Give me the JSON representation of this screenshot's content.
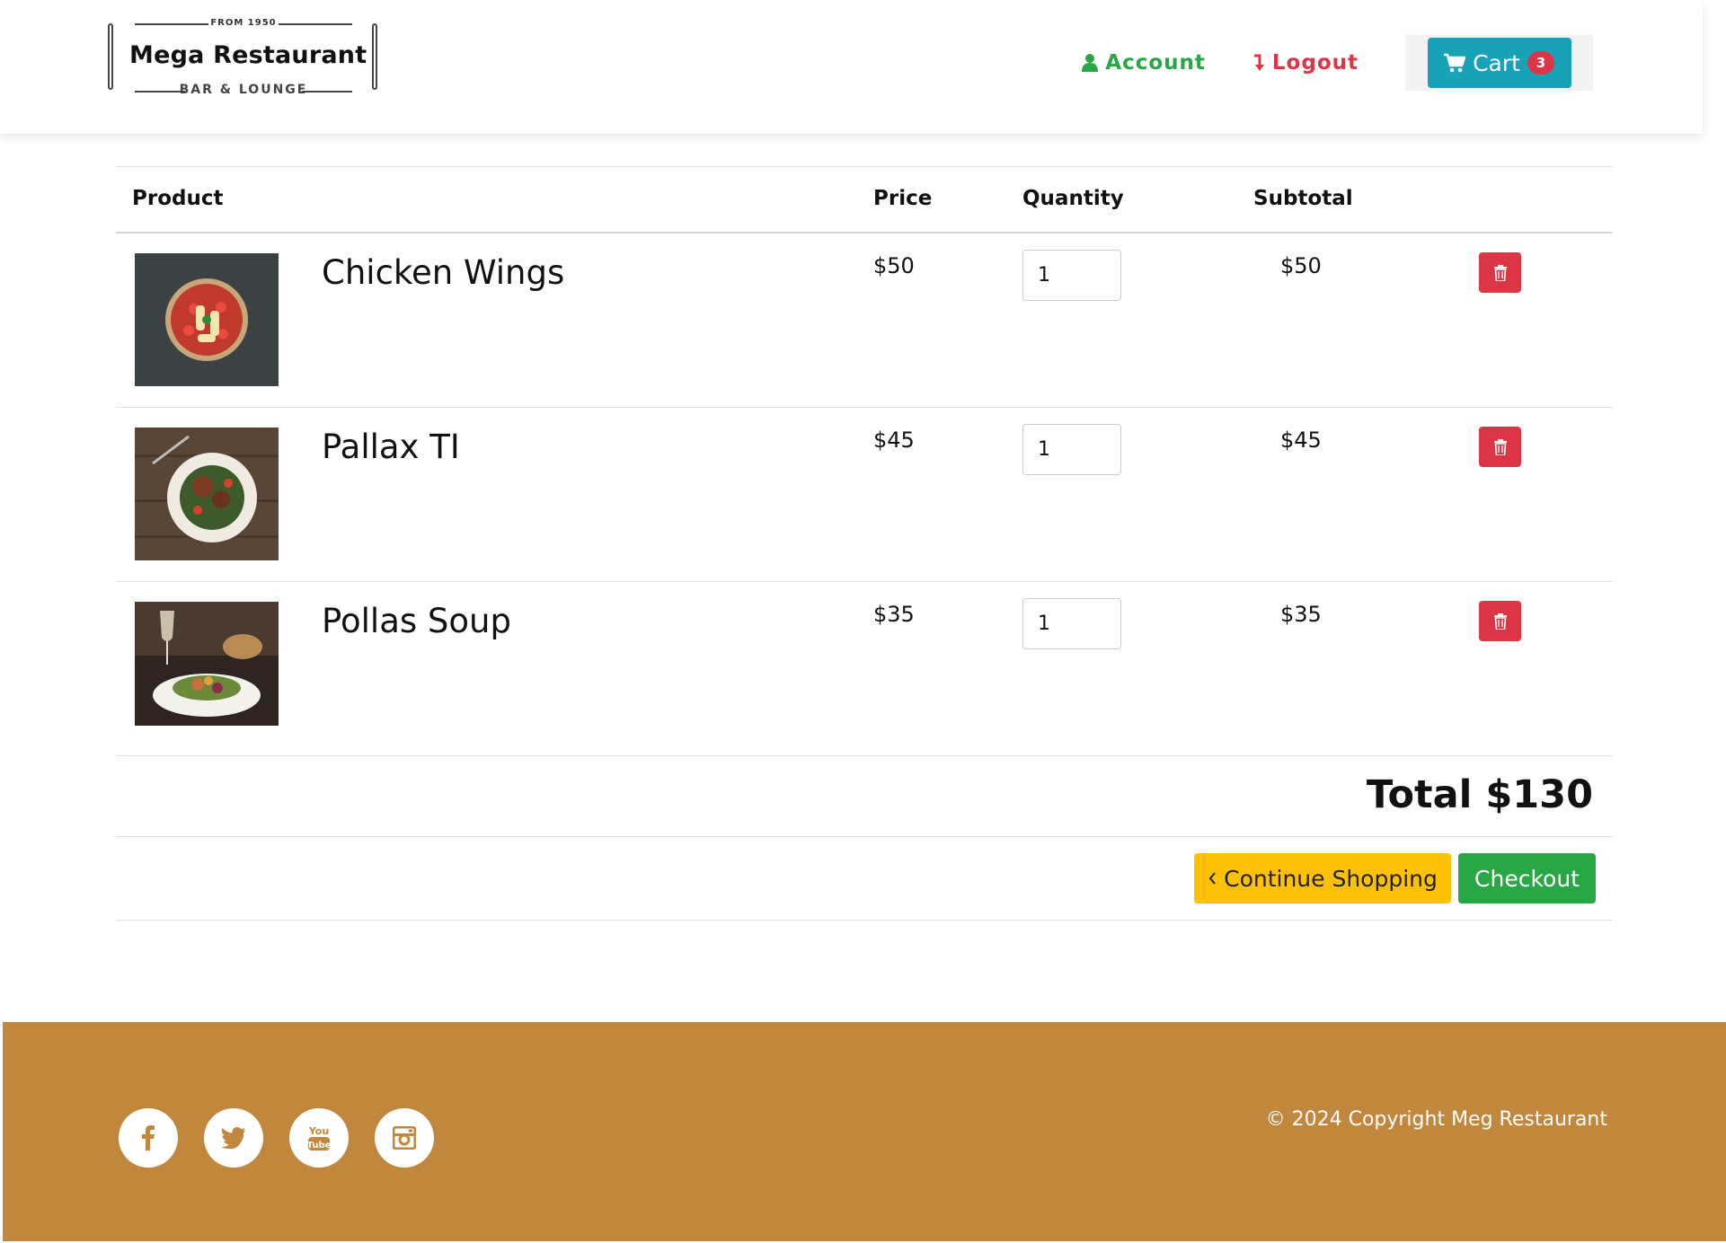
{
  "brand": {
    "from": "FROM 1950",
    "name": "Mega Restaurant",
    "tagline": "BAR & LOUNGE"
  },
  "nav": {
    "account": "Account",
    "logout": "Logout",
    "cart": "Cart",
    "cart_count": "3"
  },
  "table": {
    "headers": {
      "product": "Product",
      "price": "Price",
      "quantity": "Quantity",
      "subtotal": "Subtotal"
    },
    "rows": [
      {
        "name": "Chicken Wings",
        "price": "$50",
        "quantity": "1",
        "subtotal": "$50"
      },
      {
        "name": "Pallax TI",
        "price": "$45",
        "quantity": "1",
        "subtotal": "$45"
      },
      {
        "name": "Pollas Soup",
        "price": "$35",
        "quantity": "1",
        "subtotal": "$35"
      }
    ]
  },
  "total": "Total $130",
  "actions": {
    "continue": "Continue Shopping",
    "checkout": "Checkout"
  },
  "footer": {
    "copyright": "© 2024 Copyright Meg Restaurant",
    "social": [
      "facebook-icon",
      "twitter-icon",
      "youtube-icon",
      "instagram-icon"
    ]
  },
  "colors": {
    "success": "#28a745",
    "danger": "#dc3545",
    "info": "#17a2b8",
    "warning": "#ffc107",
    "footer": "#c1873c"
  }
}
